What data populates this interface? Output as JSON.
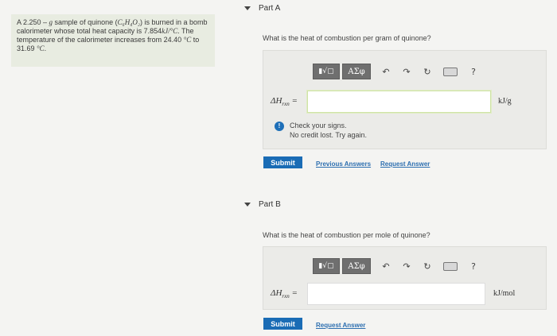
{
  "problem": {
    "p1": "A 2.250 – ",
    "g": "g",
    "p2": " sample of quinone (",
    "formula": "C₆H₄O₂",
    "p3": ") is burned in a bomb calorimeter whose total heat capacity is 7.854",
    "cap_unit": "kJ/°C",
    "p4": ". The temperature of the calorimeter increases from 24.40 ",
    "c1": "°C",
    "p5": " to 31.69 ",
    "c2": "°C",
    "p6": "."
  },
  "toolbar": {
    "frac_label": "▮√▢",
    "greek_label": "ΑΣφ",
    "undo_glyph": "↶",
    "redo_glyph": "↷",
    "reset_glyph": "↻",
    "help_glyph": "?"
  },
  "partA": {
    "title": "Part A",
    "question": "What is the heat of combustion per gram of quinone?",
    "symbol": "ΔH",
    "subscript": "rxn",
    "equals": " =",
    "answer_value": "",
    "unit": "kJ/g",
    "feedback_line1": "Check your signs.",
    "feedback_line2": "No credit lost. Try again.",
    "feedback_icon": "!",
    "submit_label": "Submit",
    "previous_answers_label": "Previous Answers",
    "request_answer_label": "Request Answer"
  },
  "partB": {
    "title": "Part B",
    "question": "What is the heat of combustion per mole of quinone?",
    "symbol": "ΔH",
    "subscript": "rxn",
    "equals": " =",
    "answer_value": "",
    "unit": "kJ/mol",
    "submit_label": "Submit",
    "request_answer_label": "Request Answer"
  }
}
